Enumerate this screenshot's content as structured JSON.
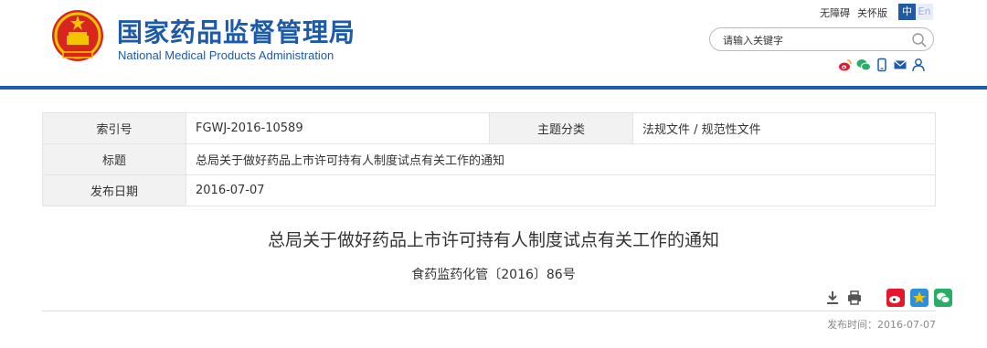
{
  "site": {
    "name_cn": "国家药品监督管理局",
    "name_en": "National Medical Products Administration"
  },
  "top_links": {
    "accessibility": "无障碍",
    "care_mode": "关怀版",
    "lang_cn": "中",
    "lang_en": "En"
  },
  "search": {
    "placeholder": "请输入关键字"
  },
  "social_icons": [
    "weibo-icon",
    "wechat-icon",
    "mobile-icon",
    "mail-icon",
    "user-icon"
  ],
  "meta": {
    "index_label": "索引号",
    "index_value": "FGWJ-2016-10589",
    "category_label": "主题分类",
    "category_value": "法规文件 / 规范性文件",
    "title_label": "标题",
    "title_value": "总局关于做好药品上市许可持有人制度试点有关工作的通知",
    "date_label": "发布日期",
    "date_value": "2016-07-07"
  },
  "article": {
    "title": "总局关于做好药品上市许可持有人制度试点有关工作的通知",
    "doc_number": "食药监药化管〔2016〕86号",
    "publish_time": "发布时间：2016-07-07"
  },
  "colors": {
    "brand_blue": "#1d5aa8",
    "emblem_red": "#d7261e",
    "emblem_gold": "#f5c400"
  }
}
